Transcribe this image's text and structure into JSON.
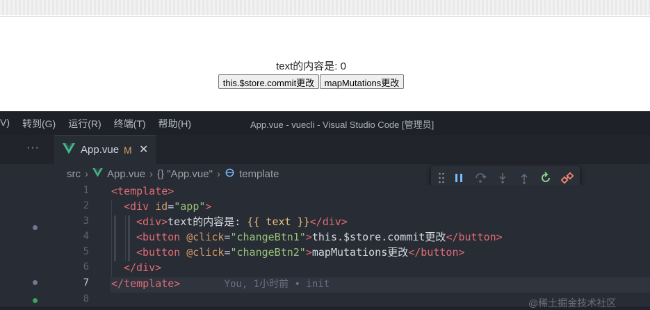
{
  "preview": {
    "text_prefix": "text的内容是: ",
    "text_value": "0",
    "buttons": [
      "this.$store.commit更改",
      "mapMutations更改"
    ]
  },
  "titlebar": {
    "menu": [
      "V)",
      "转到(G)",
      "运行(R)",
      "终端(T)",
      "帮助(H)"
    ],
    "title": "App.vue - vuecli - Visual Studio Code [管理员]"
  },
  "tabs": {
    "more": "···",
    "active": {
      "name": "App.vue",
      "status": "M",
      "close": "✕"
    }
  },
  "breadcrumb": {
    "items": [
      "src",
      "App.vue",
      "{} \"App.vue\"",
      "template"
    ]
  },
  "editor": {
    "line_numbers": [
      "1",
      "2",
      "3",
      "4",
      "5",
      "6",
      "7",
      "8"
    ],
    "active_line": "7",
    "blame": "You, 1小时前 • init",
    "lines": [
      {
        "kind": "tag",
        "t": "<template>"
      },
      {
        "kind": "div_open",
        "open": "<div",
        "attr": " id",
        "eq": "=",
        "val": "\"app\"",
        "close": ">"
      },
      {
        "kind": "div_text",
        "open": "<div>",
        "text": "text的内容是: ",
        "mus": "{{ text }}",
        "close": "</div>"
      },
      {
        "kind": "button",
        "open": "<button",
        "attr": " @click",
        "eq": "=",
        "val": "\"changeBtn1\"",
        "gt": ">",
        "text": "this.$store.commit更改",
        "close": "</button>"
      },
      {
        "kind": "button",
        "open": "<button",
        "attr": " @click",
        "eq": "=",
        "val": "\"changeBtn2\"",
        "gt": ">",
        "text": "mapMutations更改",
        "close": "</button>"
      },
      {
        "kind": "tag",
        "t": "</div>"
      },
      {
        "kind": "tag",
        "t": "</template>"
      }
    ]
  },
  "watermark": "@稀土掘金技术社区",
  "colors": {
    "vue_green": "#42b883",
    "tag": "#e06c75",
    "attr": "#d19a66",
    "string": "#98c379",
    "mustache": "#e5c07b"
  }
}
